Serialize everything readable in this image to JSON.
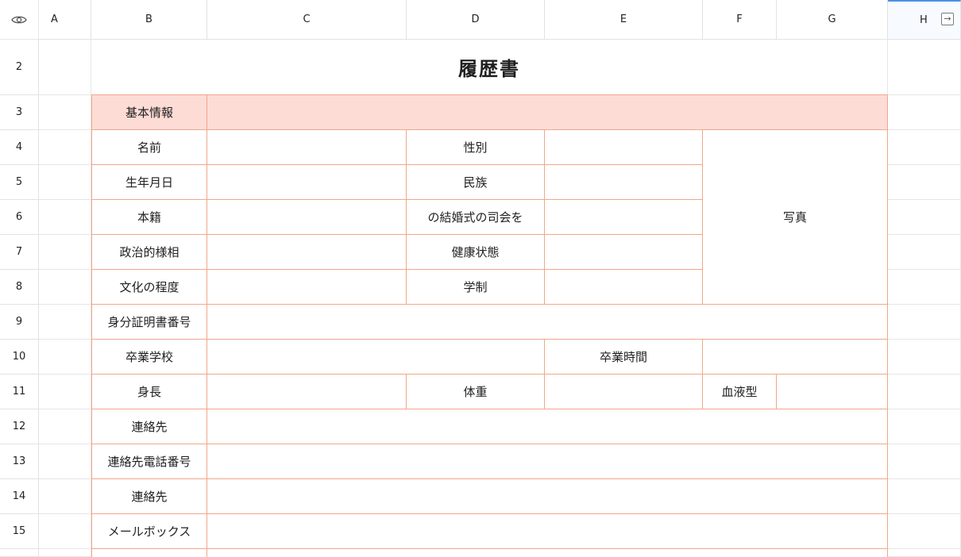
{
  "columns": [
    "A",
    "B",
    "C",
    "D",
    "E",
    "F",
    "G",
    "H"
  ],
  "selected_column": "H",
  "rows": [
    "2",
    "3",
    "4",
    "5",
    "6",
    "7",
    "8",
    "9",
    "10",
    "11",
    "12",
    "13",
    "14",
    "15"
  ],
  "icons": {
    "visibility": "eye-icon",
    "expand": "expand-icon"
  },
  "colors": {
    "header_fill": "#fedcd6",
    "border": "#f2a789",
    "selection": "#4a90e2"
  },
  "form": {
    "title": "履歴書",
    "section_basic": "基本情報",
    "labels": {
      "name": "名前",
      "gender": "性別",
      "birthdate": "生年月日",
      "ethnicity": "民族",
      "hometown": "本籍",
      "wedding_mc": "の結婚式の司会を",
      "political_status": "政治的様相",
      "health": "健康状態",
      "education_level": "文化の程度",
      "school_system": "学制",
      "id_number": "身分証明書番号",
      "graduated_school": "卒業学校",
      "graduation_time": "卒業時間",
      "height": "身長",
      "weight": "体重",
      "blood_type": "血液型",
      "contact": "連絡先",
      "contact_phone": "連絡先電話番号",
      "contact_2": "連絡先",
      "mailbox": "メールボックス"
    },
    "photo": "写真"
  }
}
